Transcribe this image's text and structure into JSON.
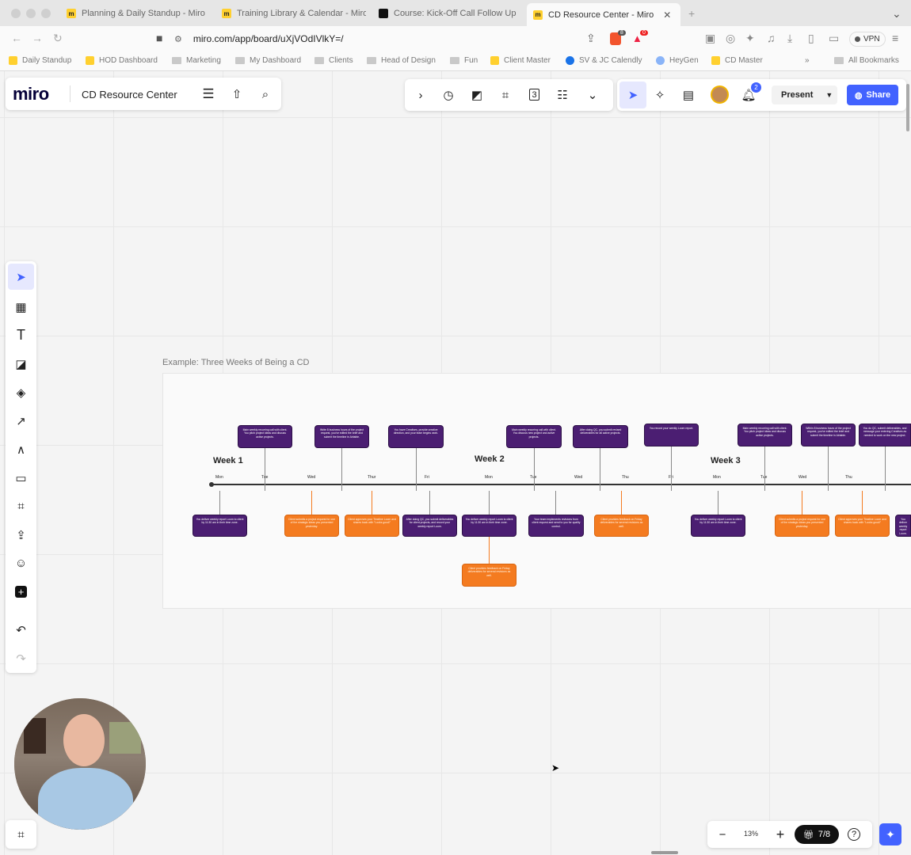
{
  "browser": {
    "tabs": [
      {
        "label": "Planning & Daily Standup - Miro"
      },
      {
        "label": "Training Library & Calendar - Miro"
      },
      {
        "label": "Course: Kick-Off Call Follow Up"
      },
      {
        "label": "CD Resource Center - Miro"
      }
    ],
    "url": "miro.com/app/board/uXjVOdIVlkY=/",
    "shield_badge": "8",
    "alert_badge": "0",
    "vpn_label": "VPN",
    "bookmarks": [
      {
        "label": "Daily Standup"
      },
      {
        "label": "HOD Dashboard"
      },
      {
        "label": "Marketing"
      },
      {
        "label": "My Dashboard"
      },
      {
        "label": "Clients"
      },
      {
        "label": "Head of Design"
      },
      {
        "label": "Fun"
      },
      {
        "label": "Client Master"
      },
      {
        "label": "SV & JC Calendly"
      },
      {
        "label": "HeyGen"
      },
      {
        "label": "CD Master"
      }
    ],
    "all_bookmarks": "All Bookmarks"
  },
  "miro": {
    "logo": "miro",
    "board_title": "CD Resource Center",
    "notifications_count": "2",
    "present_label": "Present",
    "share_label": "Share",
    "zoom": "13%",
    "frames_counter": "7/8",
    "frame_title": "Example: Three Weeks of Being a CD"
  },
  "timeline": {
    "weeks": [
      "Week 1",
      "Week 2",
      "Week 3"
    ],
    "days": [
      {
        "label": "Mon"
      },
      {
        "label": "Tue"
      },
      {
        "label": "Wed"
      },
      {
        "label": "Thur"
      },
      {
        "label": "Fri"
      },
      {
        "label": "Mon"
      },
      {
        "label": "Tue"
      },
      {
        "label": "Wed"
      },
      {
        "label": "Thu"
      },
      {
        "label": "Fri"
      },
      {
        "label": "Mon"
      },
      {
        "label": "Tue"
      },
      {
        "label": "Wed"
      },
      {
        "label": "Thu"
      }
    ],
    "top_cards": [
      {
        "text": "Main weekly recurring call with client. You pitch project ideas and discuss active projects."
      },
      {
        "text": "Write 8 business hours of the project request, you've edited the brief and submit the timeline in Airtable."
      },
      {
        "text": "You have Creatives, provide creative direction, and your team begins work."
      },
      {
        "text": "Main weekly recurring call with client. You discuss new project and active projects."
      },
      {
        "text": "After doing QC, you submit revised deliverables for all active projects."
      },
      {
        "text": "You record your weekly Loom report."
      },
      {
        "text": "Main weekly recurring call with client. You pitch project ideas and discuss active projects."
      },
      {
        "text": "Within 8 business hours of the project request, you've edited the brief and submit the timeline in Airtable."
      },
      {
        "text": "You do QC, submit deliverables, and message your entering Creatives as needed to work on the new project."
      }
    ],
    "bottom_cards": [
      {
        "text": "You deliver weekly report Loom to client by 11:30 am in their time zone."
      },
      {
        "text": "Client submits a project request for one of the strategic ideas you presented yesterday."
      },
      {
        "text": "Client approves your Timeline Loom and shares back with \"Looks good!\""
      },
      {
        "text": "After doing QC, you submit deliverables for client projects, and record your weekly report Loom."
      },
      {
        "text": "You deliver weekly report Loom to client by 11:30 am in their time zone."
      },
      {
        "text": "Your team implements revisions from client request and send to you for quality control."
      },
      {
        "text": "Client provides feedback on Friday deliverables for several revisions as well."
      },
      {
        "text": "You deliver weekly report Loom to client by 11:30 am in their time zone."
      },
      {
        "text": "Client submits a project request for one of the strategic ideas you presented yesterday."
      },
      {
        "text": "Client approves your Timeline Loom and shares back with \"Looks good!\""
      },
      {
        "text": "You deliver weekly report Loom."
      }
    ],
    "extra_card": {
      "text": "Client provides feedback on Friday deliverables for several revisions as well."
    }
  }
}
